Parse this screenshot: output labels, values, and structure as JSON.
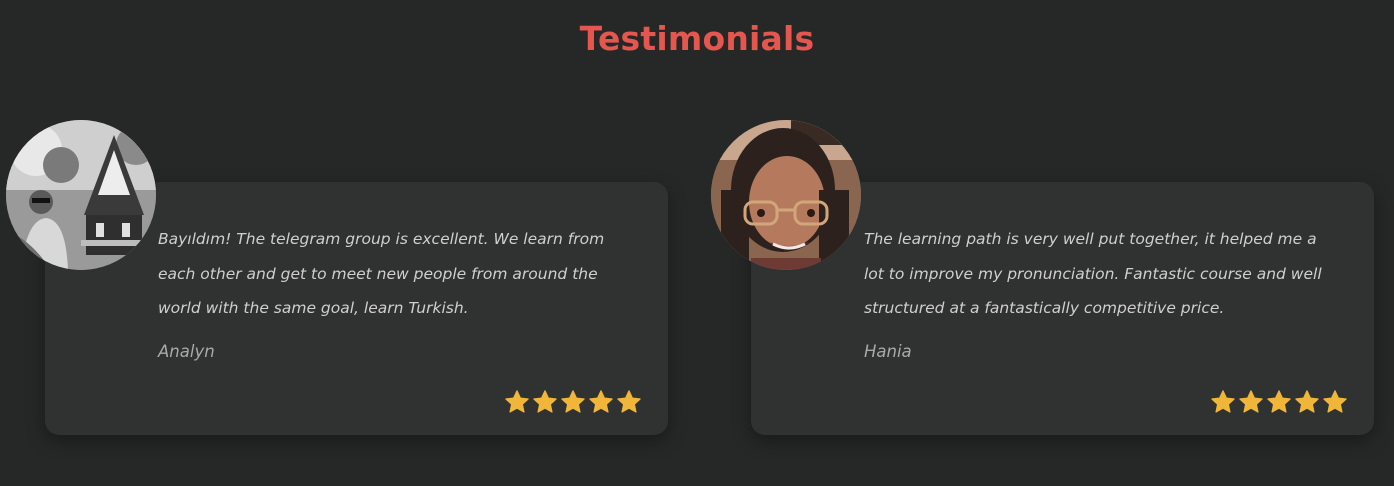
{
  "section": {
    "title": "Testimonials"
  },
  "testimonials": [
    {
      "quote": "Bayıldım! The telegram group is excellent. We learn from each other and get to meet new people from around the world with the same goal, learn Turkish.",
      "author": "Analyn",
      "rating": 5,
      "avatar_icon": "user-photo-grayscale"
    },
    {
      "quote": "The learning path is very well put together, it helped me a lot to improve my pronunciation. Fantastic course and well structured at a fantastically competitive price.",
      "author": "Hania",
      "rating": 5,
      "avatar_icon": "user-photo-color"
    }
  ],
  "colors": {
    "background": "#262727",
    "card": "#303131",
    "title": "#e5564f",
    "star": "#f0b63a",
    "quote_text": "#cfcfcf",
    "author_text": "#a9a9a9"
  }
}
